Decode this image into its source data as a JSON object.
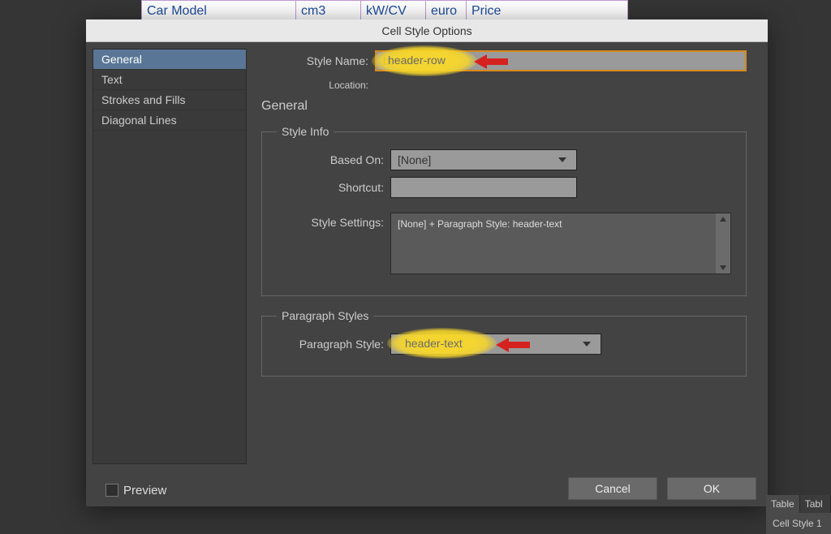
{
  "bg_table": {
    "headers": [
      "Car Model",
      "cm3",
      "kW/CV",
      "euro",
      "Price"
    ]
  },
  "dialog": {
    "title": "Cell Style Options",
    "sidebar": {
      "items": [
        {
          "label": "General",
          "selected": true
        },
        {
          "label": "Text",
          "selected": false
        },
        {
          "label": "Strokes and Fills",
          "selected": false
        },
        {
          "label": "Diagonal Lines",
          "selected": false
        }
      ]
    },
    "preview": {
      "label": "Preview",
      "checked": false
    },
    "main": {
      "style_name_label": "Style Name:",
      "style_name_value": "header-row",
      "location_label": "Location:",
      "section_title": "General",
      "style_info": {
        "legend": "Style Info",
        "based_on_label": "Based On:",
        "based_on_value": "[None]",
        "shortcut_label": "Shortcut:",
        "style_settings_label": "Style Settings:",
        "style_settings_value": "[None] + Paragraph Style: header-text"
      },
      "para_styles": {
        "legend": "Paragraph Styles",
        "label": "Paragraph Style:",
        "value": "header-text"
      }
    },
    "buttons": {
      "cancel": "Cancel",
      "ok": "OK"
    }
  },
  "panel": {
    "tabs": [
      "Table",
      "Tabl"
    ],
    "row": "Cell Style 1"
  }
}
